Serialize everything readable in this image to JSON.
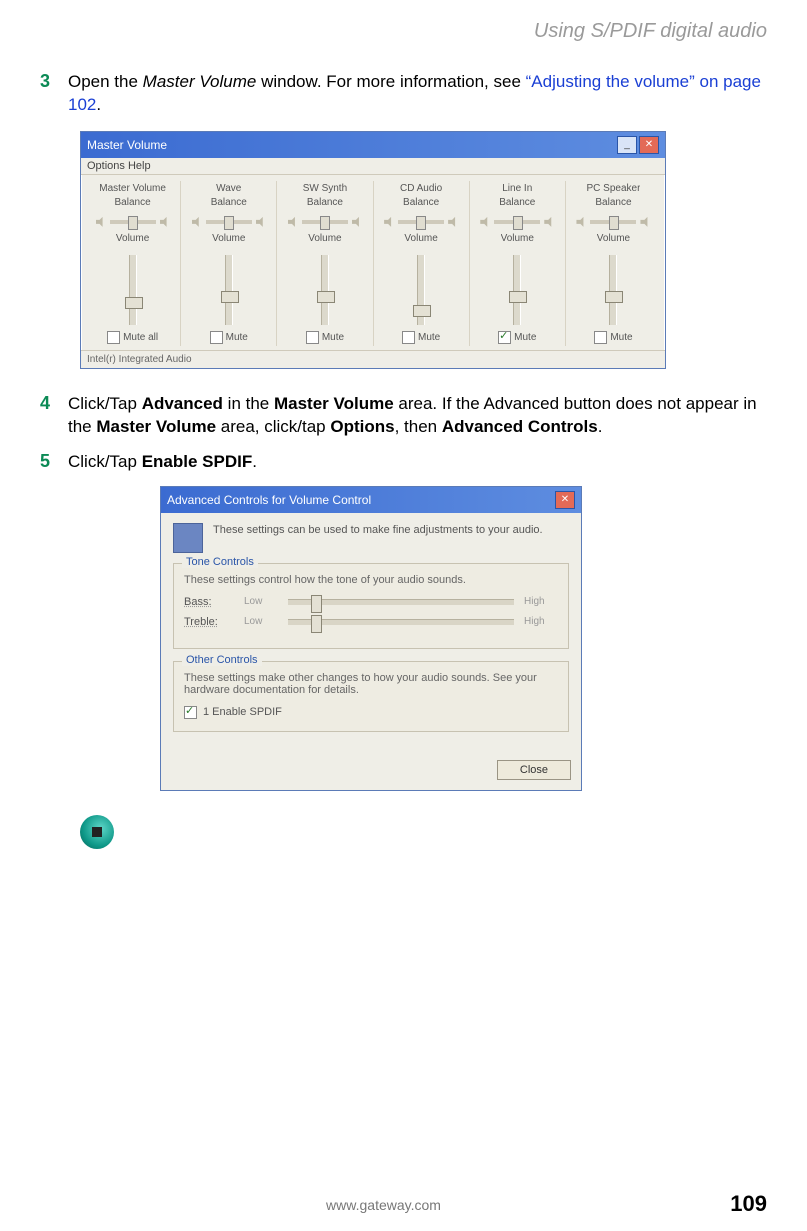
{
  "header": {
    "section_title": "Using S/PDIF digital audio"
  },
  "steps": {
    "s3": {
      "num": "3",
      "pre": "Open the ",
      "ital": "Master Volume",
      "post": " window. For more information, see ",
      "link": "“Adjusting the volume” on page 102",
      "end": "."
    },
    "s4": {
      "num": "4",
      "t1": "Click/Tap ",
      "b1": "Advanced",
      "t2": " in the ",
      "b2": "Master Volume",
      "t3": " area. If the Advanced button does not appear in the ",
      "b3": "Master Volume",
      "t4": " area, click/tap ",
      "b4": "Options",
      "t5": ", then ",
      "b5": "Advanced Controls",
      "t6": "."
    },
    "s5": {
      "num": "5",
      "t1": "Click/Tap ",
      "b1": "Enable SPDIF",
      "t2": "."
    }
  },
  "master_volume": {
    "title": "Master Volume",
    "menu": "Options   Help",
    "status": "Intel(r) Integrated Audio",
    "labels": {
      "balance": "Balance",
      "volume": "Volume"
    },
    "cols": [
      {
        "name": "Master Volume",
        "mute": "Mute all",
        "checked": false,
        "thumb": 60
      },
      {
        "name": "Wave",
        "mute": "Mute",
        "checked": false,
        "thumb": 52
      },
      {
        "name": "SW Synth",
        "mute": "Mute",
        "checked": false,
        "thumb": 52
      },
      {
        "name": "CD Audio",
        "mute": "Mute",
        "checked": false,
        "thumb": 72
      },
      {
        "name": "Line In",
        "mute": "Mute",
        "checked": true,
        "thumb": 52
      },
      {
        "name": "PC Speaker",
        "mute": "Mute",
        "checked": false,
        "thumb": 52
      }
    ]
  },
  "advanced": {
    "title": "Advanced Controls for Volume Control",
    "desc": "These settings can be used to make fine adjustments to your audio.",
    "tone": {
      "title": "Tone Controls",
      "desc": "These settings control how the tone of your audio sounds.",
      "bass": "Bass:",
      "treble": "Treble:",
      "low": "Low",
      "high": "High"
    },
    "other": {
      "title": "Other Controls",
      "desc": "These settings make other changes to how your audio sounds. See your hardware documentation for details.",
      "chk_label": "1  Enable SPDIF"
    },
    "close": "Close"
  },
  "footer": {
    "url": "www.gateway.com",
    "page": "109"
  }
}
